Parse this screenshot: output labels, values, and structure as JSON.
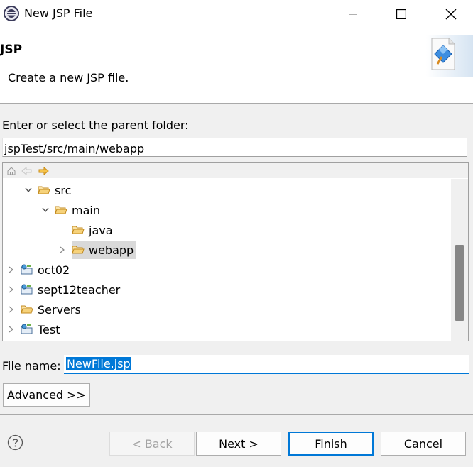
{
  "window": {
    "title": "New JSP File",
    "icon": "eclipse-icon"
  },
  "banner": {
    "title": "JSP",
    "description": "Create a new JSP file.",
    "image_icon": "jsp-wizard-icon"
  },
  "parent_folder": {
    "label": "Enter or select the parent folder:",
    "value": "jspTest/src/main/webapp"
  },
  "tree_toolbar": {
    "icons": [
      "home-icon",
      "back-arrow-icon",
      "forward-arrow-icon"
    ]
  },
  "tree": {
    "items": [
      {
        "label": "src",
        "expanded": true,
        "icon": "folder-icon"
      },
      {
        "label": "main",
        "expanded": true,
        "icon": "folder-icon"
      },
      {
        "label": "java",
        "icon": "folder-icon"
      },
      {
        "label": "webapp",
        "expanded": false,
        "selected": true,
        "icon": "folder-icon"
      },
      {
        "label": "oct02",
        "expanded": false,
        "icon": "project-icon"
      },
      {
        "label": "sept12teacher",
        "expanded": false,
        "icon": "project-icon"
      },
      {
        "label": "Servers",
        "expanded": false,
        "icon": "folder-icon"
      },
      {
        "label": "Test",
        "expanded": false,
        "icon": "project-icon"
      }
    ]
  },
  "file_name": {
    "label": "File name:",
    "value": "NewFile.jsp"
  },
  "buttons": {
    "advanced": "Advanced >>",
    "back": "< Back",
    "next": "Next >",
    "finish": "Finish",
    "cancel": "Cancel"
  },
  "colors": {
    "accent": "#0078d7",
    "folder": "#e8b04b",
    "selection": "#d9d9d9"
  }
}
